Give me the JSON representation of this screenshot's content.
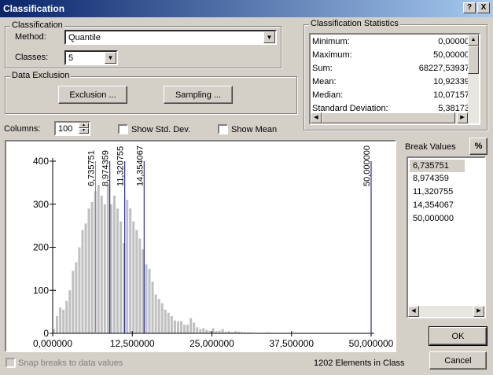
{
  "window": {
    "title": "Classification",
    "help_label": "?",
    "close_label": "X"
  },
  "classification": {
    "group_label": "Classification",
    "method_label": "Method:",
    "method_value": "Quantile",
    "classes_label": "Classes:",
    "classes_value": "5"
  },
  "exclusion": {
    "group_label": "Data Exclusion",
    "exclusion_button": "Exclusion ...",
    "sampling_button": "Sampling ..."
  },
  "statistics": {
    "group_label": "Classification Statistics",
    "rows": [
      {
        "name": "Minimum:",
        "value": "0,00000"
      },
      {
        "name": "Maximum:",
        "value": "50,00000"
      },
      {
        "name": "Sum:",
        "value": "68227,53937"
      },
      {
        "name": "Mean:",
        "value": "10,92339"
      },
      {
        "name": "Median:",
        "value": "10,07157"
      },
      {
        "name": "Standard Deviation:",
        "value": "5,38173"
      }
    ]
  },
  "options": {
    "columns_label": "Columns:",
    "columns_value": "100",
    "show_std_dev_label": "Show Std. Dev.",
    "show_std_dev_checked": false,
    "show_mean_label": "Show Mean",
    "show_mean_checked": false
  },
  "chart_data": {
    "type": "bar",
    "xlim": [
      0,
      50
    ],
    "ylim": [
      0,
      400
    ],
    "x_ticks": [
      {
        "value": 0,
        "label": "0,000000"
      },
      {
        "value": 12.5,
        "label": "12,500000"
      },
      {
        "value": 25,
        "label": "25,000000"
      },
      {
        "value": 37.5,
        "label": "37,500000"
      },
      {
        "value": 50,
        "label": "50,000000"
      }
    ],
    "y_ticks": [
      {
        "value": 0,
        "label": "0"
      },
      {
        "value": 100,
        "label": "100"
      },
      {
        "value": 200,
        "label": "200"
      },
      {
        "value": 300,
        "label": "300"
      },
      {
        "value": 400,
        "label": "400"
      }
    ],
    "bin_width": 0.5,
    "values": [
      10,
      40,
      60,
      55,
      75,
      100,
      145,
      165,
      200,
      240,
      255,
      290,
      305,
      330,
      345,
      320,
      300,
      345,
      300,
      320,
      290,
      260,
      210,
      310,
      290,
      260,
      240,
      220,
      195,
      160,
      150,
      120,
      90,
      80,
      70,
      55,
      48,
      40,
      30,
      28,
      28,
      20,
      20,
      35,
      25,
      14,
      10,
      12,
      8,
      6,
      12,
      5,
      6,
      10,
      4,
      5,
      3,
      5,
      4,
      3,
      2,
      2,
      2,
      1,
      1,
      1,
      1,
      2,
      1,
      1,
      1,
      1,
      1,
      1,
      1,
      1,
      0,
      1,
      0,
      1,
      0,
      1,
      0,
      0,
      1,
      0,
      0,
      1,
      0,
      0,
      0,
      0,
      0,
      0,
      0,
      1,
      0,
      0,
      0,
      0
    ],
    "break_lines": [
      {
        "value": 6.735751,
        "label": "6,735751",
        "color": "#e06060"
      },
      {
        "value": 8.974359,
        "label": "8,974359",
        "color": "#00008b"
      },
      {
        "value": 11.320755,
        "label": "11,320755",
        "color": "#00008b"
      },
      {
        "value": 14.354067,
        "label": "14,354067",
        "color": "#00008b"
      },
      {
        "value": 50.0,
        "label": "50,000000",
        "color": "#00008b"
      }
    ],
    "bar_color": "#c0c0c0"
  },
  "break_values": {
    "header": "Break Values",
    "percent_button": "%",
    "items": [
      "6,735751",
      "8,974359",
      "11,320755",
      "14,354067",
      "50,000000"
    ],
    "selected_index": 0
  },
  "footer": {
    "snap_label": "Snap breaks to data values",
    "elements_text": "1202 Elements in Class",
    "ok_label": "OK",
    "cancel_label": "Cancel"
  }
}
